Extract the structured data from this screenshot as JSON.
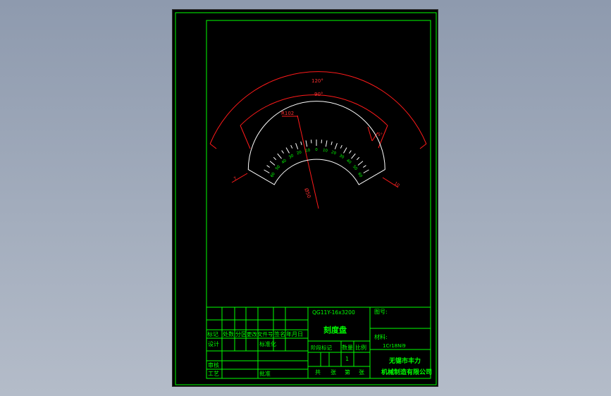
{
  "drawing": {
    "dimensions": {
      "angle_outer": "120°",
      "angle_inner": "90°",
      "radius": "R102",
      "diameter": "Ø50",
      "tick_step": "5°",
      "left_offset": "7",
      "right_offset": "10"
    },
    "scale_labels": [
      "60",
      "50",
      "40",
      "30",
      "20",
      "10",
      "0",
      "10",
      "20",
      "30",
      "40",
      "50",
      "60"
    ]
  },
  "title_block": {
    "drawing_number": "QG11Y-16x3200",
    "part_name": "刻度盘",
    "figure_label": "图号:",
    "material_label": "材料:",
    "material_value": "1Cr18Ni9",
    "company_line1": "无锡市丰力",
    "company_line2": "机械制造有限公司",
    "header_row": [
      "标记",
      "处数",
      "分区",
      "更改文件号",
      "签名",
      "年月日"
    ],
    "row_design": "设计",
    "row_standard": "标准化",
    "row_review": "审核",
    "row_process": "工艺",
    "row_approve": "批准",
    "stage_header": [
      "阶段标记",
      "数量",
      "比例"
    ],
    "quantity": "1",
    "sheet_info": [
      "共",
      "张",
      "第",
      "张"
    ]
  }
}
